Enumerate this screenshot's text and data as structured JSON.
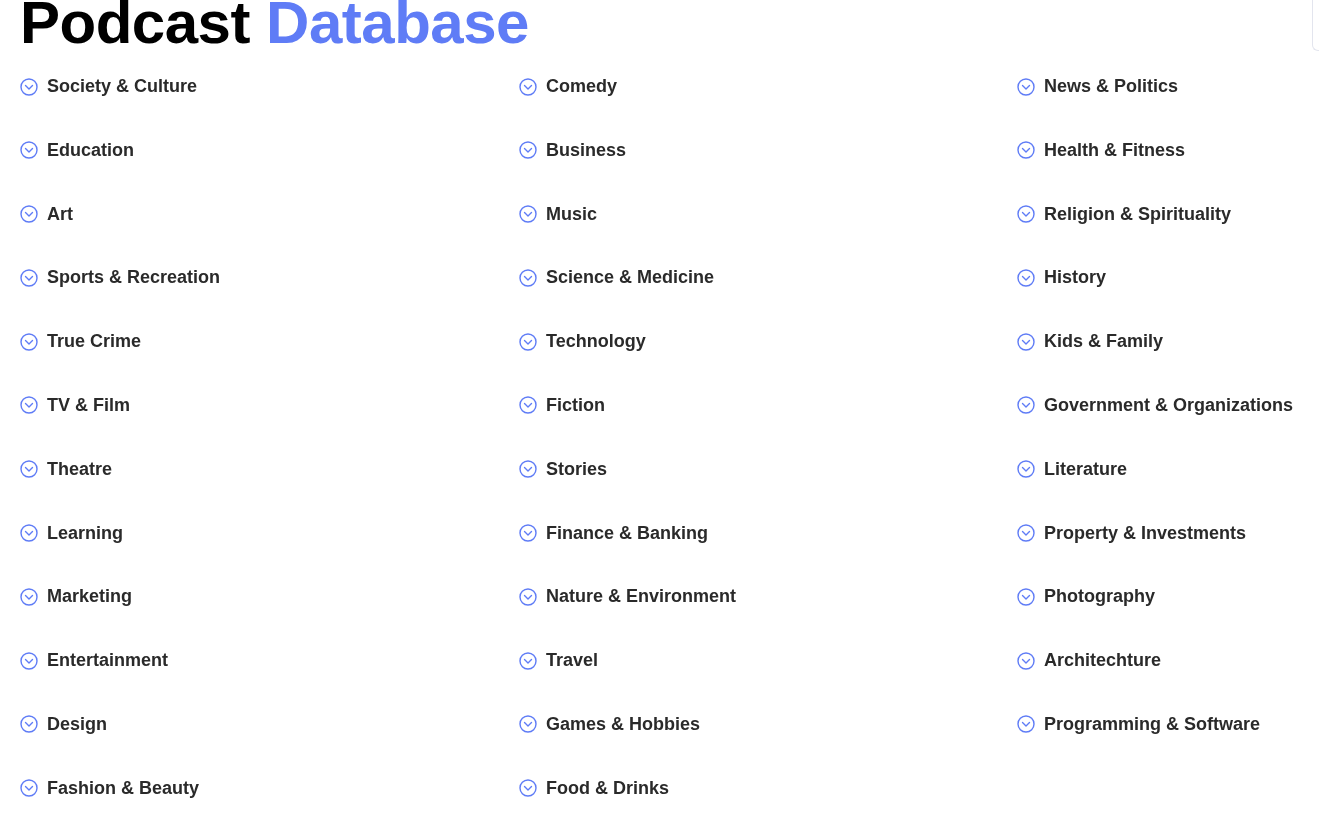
{
  "title": {
    "text": "Podcast",
    "highlight": "Database"
  },
  "categories": [
    "Society & Culture",
    "Comedy",
    "News & Politics",
    "Education",
    "Business",
    "Health & Fitness",
    "Art",
    "Music",
    "Religion & Spirituality",
    "Sports & Recreation",
    "Science & Medicine",
    "History",
    "True Crime",
    "Technology",
    "Kids & Family",
    "TV & Film",
    "Fiction",
    "Government & Organizations",
    "Theatre",
    "Stories",
    "Literature",
    "Learning",
    "Finance & Banking",
    "Property & Investments",
    "Marketing",
    "Nature & Environment",
    "Photography",
    "Entertainment",
    "Travel",
    "Architechture",
    "Design",
    "Games & Hobbies",
    "Programming & Software",
    "Fashion & Beauty",
    "Food & Drinks"
  ]
}
